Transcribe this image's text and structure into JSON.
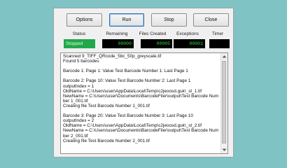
{
  "toolbar": {
    "options_label": "Options",
    "run_label": "Run",
    "stop_label": "Stop",
    "close_label": "Close"
  },
  "stats": {
    "status_label": "Status",
    "remaining_label": "Remaining",
    "files_created_label": "Files Created",
    "exceptions_label": "Exceptions",
    "timer_label": "Timer",
    "status_value": "Stopped",
    "remaining_value": "00000",
    "files_created_value": "00005",
    "exceptions_value": "00001",
    "timer_value": ""
  },
  "log": {
    "lines": [
      "Scanned 9_TIFF_QRcode_5bc_50p_greyscale.tif",
      "Found 5 barcodes",
      "",
      "Barcode 1: Page 1: Value Test Barcode Number 1: Last Page 1",
      "",
      "Barcode 2: Page 10: Value Test Barcode Number 2: Last Page 1",
      "outputIndex = 1",
      "OldName = C:\\Users\\user\\AppData\\Local\\Temp\\c2jeoosd.guk\\_st_1.tif",
      "NewName = C:\\Users\\user\\Documents\\BarcodeFiler\\output\\Test Barcode Number 1_001.tif",
      "Creating file Test Barcode Number 1_001.tif",
      "",
      "Barcode 3: Page 20: Value Test Barcode Number 3: Last Page 10",
      "outputIndex = 2",
      "OldName = C:\\Users\\user\\AppData\\Local\\Temp\\c2jeoosd.guk\\_st_2.tif",
      "NewName = C:\\Users\\user\\Documents\\BarcodeFiler\\output\\Test Barcode Number 2_001.tif",
      "Creating file Test Barcode Number 2_001.tif"
    ]
  },
  "icons": {
    "scroll_up": "scroll-up-arrow-icon",
    "scroll_down": "scroll-down-arrow-icon"
  },
  "colors": {
    "status_stopped": "#21a84a",
    "counter_text": "#2bdf3a",
    "background": "#7fc3c5"
  }
}
